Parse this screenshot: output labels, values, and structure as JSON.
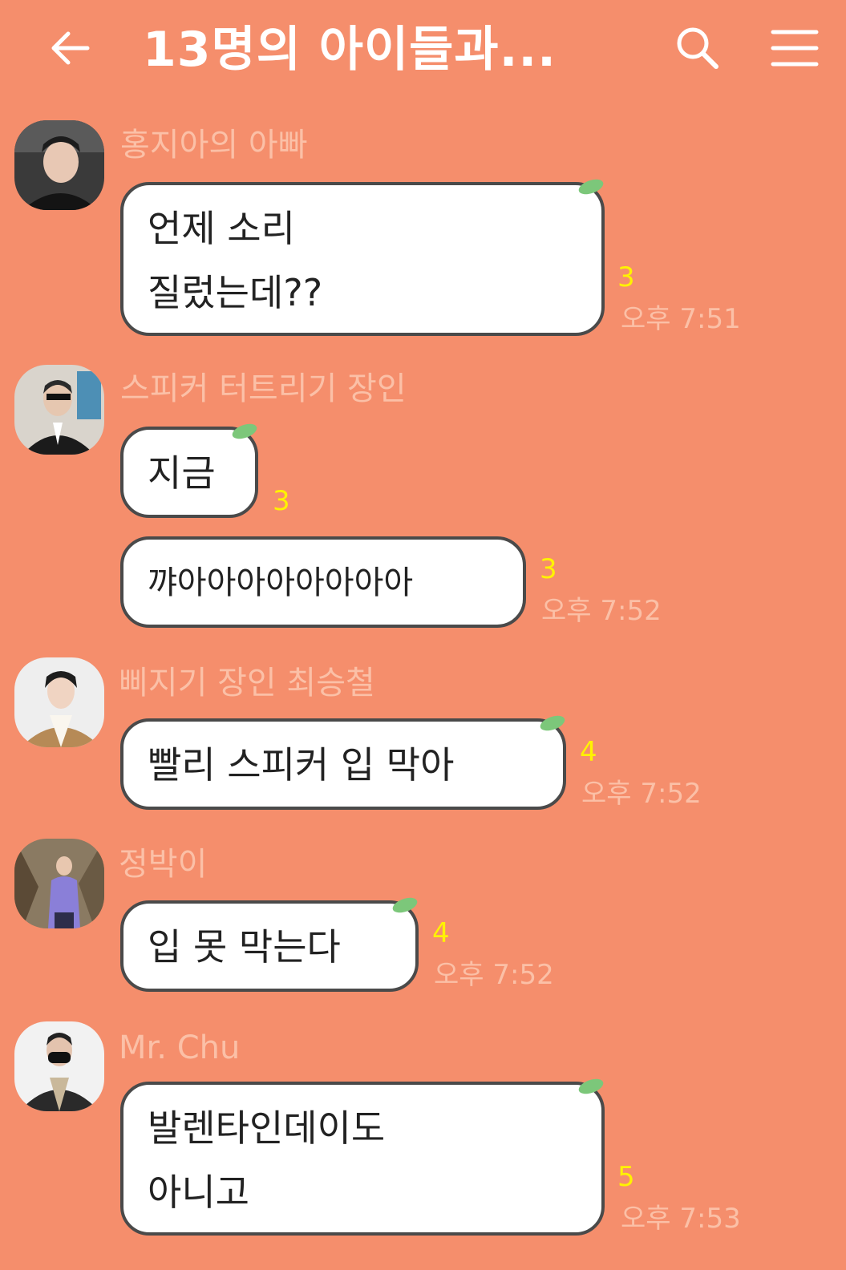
{
  "header": {
    "title": "13명의 아이들과...",
    "back_icon": "arrow-left-icon",
    "search_icon": "search-icon",
    "menu_icon": "hamburger-menu-icon"
  },
  "colors": {
    "background": "#F58E6C",
    "bubble": "#FFFFFF",
    "sender_name": "#FBC0A7",
    "unread_count": "#FFF200",
    "leaf": "#7CC77A"
  },
  "messages": [
    {
      "sender": "홍지아의 아빠",
      "bubbles": [
        {
          "lines": [
            "언제 소리",
            "질렀는데??"
          ],
          "count": "3",
          "time": "오후 7:51"
        }
      ]
    },
    {
      "sender": "스피커 터트리기 장인",
      "bubbles": [
        {
          "lines": [
            "지금"
          ],
          "count": "3",
          "time": ""
        },
        {
          "lines": [
            "꺄아아아아아아아아"
          ],
          "count": "3",
          "time": "오후 7:52"
        }
      ]
    },
    {
      "sender": "삐지기 장인 최승철",
      "bubbles": [
        {
          "lines": [
            "빨리 스피커 입 막아"
          ],
          "count": "4",
          "time": "오후 7:52"
        }
      ]
    },
    {
      "sender": "정박이",
      "bubbles": [
        {
          "lines": [
            "입 못 막는다"
          ],
          "count": "4",
          "time": "오후 7:52"
        }
      ]
    },
    {
      "sender": "Mr. Chu",
      "bubbles": [
        {
          "lines": [
            "발렌타인데이도",
            "아니고"
          ],
          "count": "5",
          "time": "오후 7:53"
        }
      ]
    }
  ]
}
